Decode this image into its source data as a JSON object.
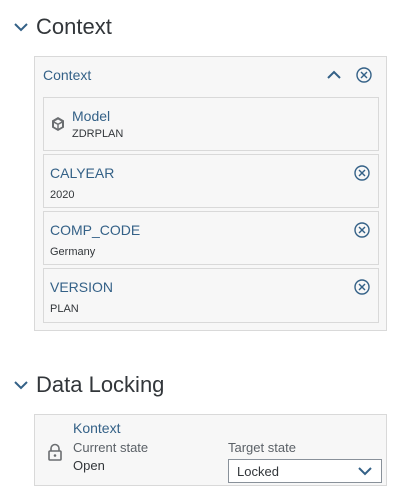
{
  "context_section": {
    "title": "Context",
    "panel_title": "Context",
    "model": {
      "label": "Model",
      "value": "ZDRPLAN"
    },
    "filters": [
      {
        "label": "CALYEAR",
        "value": "2020"
      },
      {
        "label": "COMP_CODE",
        "value": "Germany"
      },
      {
        "label": "VERSION",
        "value": "PLAN"
      }
    ]
  },
  "data_locking_section": {
    "title": "Data Locking",
    "panel_title": "Kontext",
    "current_state_label": "Current state",
    "current_state_value": "Open",
    "target_state_label": "Target state",
    "target_state_selected": "Locked"
  },
  "colors": {
    "link_blue": "#346187",
    "text": "#32363a",
    "panel_bg": "#f7f7f7",
    "border": "#d9d9d9"
  },
  "icons": {
    "section_toggle": "chevron-down-icon",
    "collapse": "chevron-up-icon",
    "remove": "circle-x-icon",
    "model": "cube-icon",
    "lock": "lock-icon",
    "select": "chevron-down-icon"
  }
}
